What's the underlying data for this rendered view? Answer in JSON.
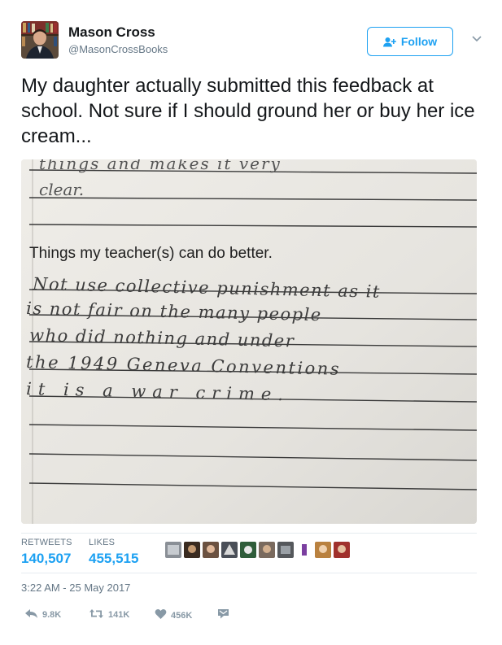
{
  "author": {
    "name": "Mason Cross",
    "handle": "@MasonCrossBooks"
  },
  "follow_button": {
    "label": "Follow"
  },
  "tweet": {
    "text": "My daughter actually submitted this feedback at school. Not sure if I should ground her or buy her ice cream..."
  },
  "photo": {
    "lines": {
      "top_partial": "things and makes it very",
      "top_partial_2": "clear.",
      "prompt": "Things my teacher(s)  can do better.",
      "hand_1": "Not use collective punishment as it",
      "hand_2": "is not fair on the many people",
      "hand_3": "who did nothing and under",
      "hand_4": "the 1949 Geneva Conventions",
      "hand_5": "it is a war crime."
    }
  },
  "stats": {
    "retweets_label": "RETWEETS",
    "retweets_value": "140,507",
    "likes_label": "LIKES",
    "likes_value": "455,515"
  },
  "liker_avatars": [
    {
      "color": "#8a8f96"
    },
    {
      "color": "#3a2b20"
    },
    {
      "color": "#6b5140"
    },
    {
      "color": "#4a4f58"
    },
    {
      "color": "#2f5d3a"
    },
    {
      "color": "#7a6a5e"
    },
    {
      "color": "#55585c"
    },
    {
      "color": "#7b3fa0"
    },
    {
      "color": "#b9813f"
    },
    {
      "color": "#a0302c"
    }
  ],
  "timestamp": "3:22 AM - 25 May 2017",
  "actions": {
    "reply_count": "9.8K",
    "retweet_count": "141K",
    "like_count": "456K"
  },
  "colors": {
    "accent": "#1da1f2",
    "muted": "#657786",
    "icon": "#8899a6",
    "text": "#14171a"
  },
  "icons": [
    "person-plus-icon",
    "chevron-down-icon",
    "reply-icon",
    "retweet-icon",
    "heart-icon",
    "direct-message-icon"
  ]
}
